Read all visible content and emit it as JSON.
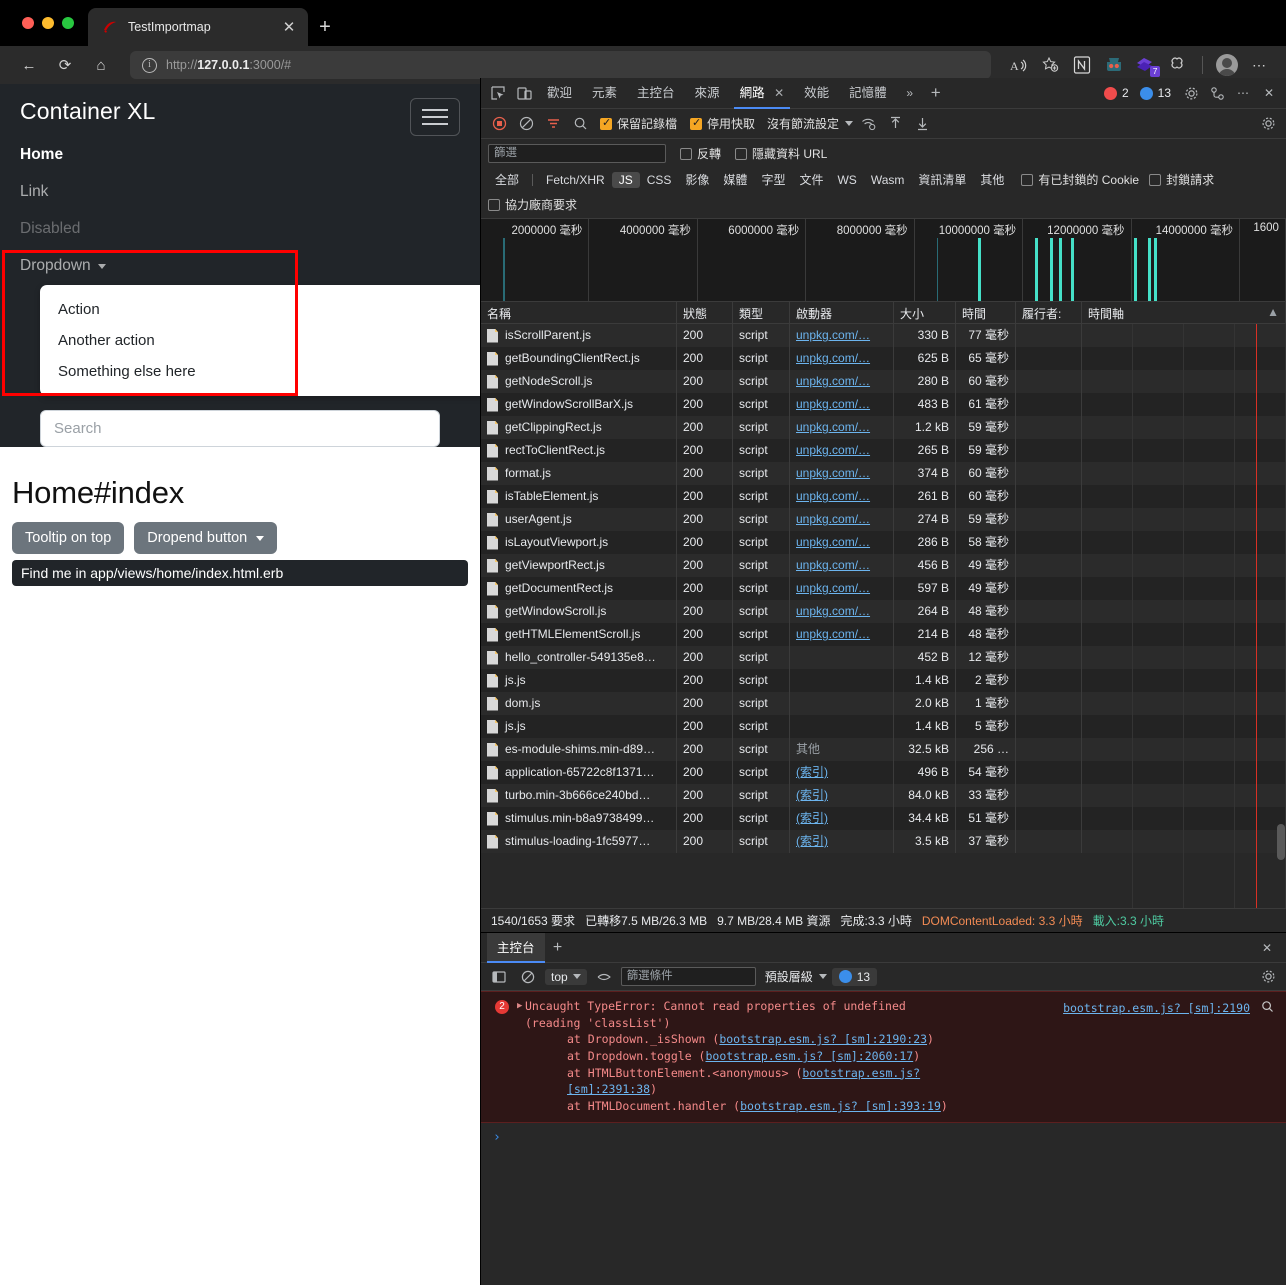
{
  "browser": {
    "tab": {
      "title": "TestImportmap",
      "close_label": "✕",
      "favicon": "rails-logo-icon"
    },
    "new_tab_label": "+",
    "nav": {
      "back": "←",
      "reload": "⟳",
      "home": "⌂"
    },
    "omnibox": {
      "info_icon": "info-circle-icon",
      "url_scheme": "http://",
      "url_host": "127.0.0.1",
      "url_rest": ":3000/#"
    },
    "toolbar_right": {
      "read_aloud": "A",
      "favorite": "☆",
      "ext_notion": "N",
      "ext_robot": "🤖",
      "ext_purple": "◆",
      "ext_badge": "7",
      "ext_puzzle": "⬡",
      "more": "⋯"
    }
  },
  "page": {
    "brand": "Container XL",
    "toggler": "navbar-toggler",
    "nav_items": [
      {
        "label": "Home",
        "state": "active"
      },
      {
        "label": "Link",
        "state": "normal"
      },
      {
        "label": "Disabled",
        "state": "disabled"
      }
    ],
    "dropdown": {
      "label": "Dropdown",
      "items": [
        "Action",
        "Another action",
        "Something else here"
      ]
    },
    "search_placeholder": "Search",
    "title": "Home#index",
    "buttons": [
      {
        "label": "Tooltip on top",
        "caret": false
      },
      {
        "label": "Dropend button",
        "caret": true
      }
    ],
    "tooltip_text": "Find me in app/views/home/index.html.erb",
    "annotation_color": "#ff0000"
  },
  "devtools": {
    "tabs": [
      {
        "label": "歡迎",
        "selected": false
      },
      {
        "label": "元素",
        "selected": false
      },
      {
        "label": "主控台",
        "selected": false
      },
      {
        "label": "來源",
        "selected": false
      },
      {
        "label": "網路",
        "selected": true,
        "closable": true
      },
      {
        "label": "效能",
        "selected": false
      },
      {
        "label": "記憶體",
        "selected": false
      }
    ],
    "more_tabs": "»",
    "add_tab": "+",
    "error_count": "2",
    "info_count": "13",
    "settings_icon": "gear-icon",
    "customize_icon": "dock-icon",
    "more_icon": "⋯",
    "close_icon": "✕",
    "network": {
      "toolbar": {
        "record_icon": "record-stop-icon",
        "clear_icon": "clear-icon",
        "filter_icon": "filter-icon",
        "search_icon": "search-icon",
        "preserve_log": "保留記錄檔",
        "disable_cache": "停用快取",
        "throttle": "沒有節流設定",
        "wifi_icon": "wifi-settings-icon",
        "import_icon": "import-har-icon",
        "export_icon": "export-har-icon",
        "settings_icon": "gear-icon"
      },
      "filter": {
        "placeholder": "篩選",
        "invert": "反轉",
        "hide_data_urls": "隱藏資料 URL",
        "types": [
          "全部",
          "Fetch/XHR",
          "JS",
          "CSS",
          "影像",
          "媒體",
          "字型",
          "文件",
          "WS",
          "Wasm",
          "資訊清單",
          "其他"
        ],
        "selected_type": "JS",
        "blocked_cookies": "有已封鎖的 Cookie",
        "blocked_requests": "封鎖請求",
        "third_party": "協力廠商要求"
      },
      "overview_ticks": [
        "2000000 毫秒",
        "4000000 毫秒",
        "6000000 毫秒",
        "8000000 毫秒",
        "10000000 毫秒",
        "12000000 毫秒",
        "14000000 毫秒",
        "1600"
      ],
      "columns": [
        "名稱",
        "狀態",
        "類型",
        "啟動器",
        "大小",
        "時間",
        "履行者:",
        "時間軸"
      ],
      "rows": [
        {
          "name": "isScrollParent.js",
          "status": "200",
          "type": "script",
          "initiator": "unpkg.com/…",
          "size": "330 B",
          "time": "77 毫秒"
        },
        {
          "name": "getBoundingClientRect.js",
          "status": "200",
          "type": "script",
          "initiator": "unpkg.com/…",
          "size": "625 B",
          "time": "65 毫秒"
        },
        {
          "name": "getNodeScroll.js",
          "status": "200",
          "type": "script",
          "initiator": "unpkg.com/…",
          "size": "280 B",
          "time": "60 毫秒"
        },
        {
          "name": "getWindowScrollBarX.js",
          "status": "200",
          "type": "script",
          "initiator": "unpkg.com/…",
          "size": "483 B",
          "time": "61 毫秒"
        },
        {
          "name": "getClippingRect.js",
          "status": "200",
          "type": "script",
          "initiator": "unpkg.com/…",
          "size": "1.2 kB",
          "time": "59 毫秒"
        },
        {
          "name": "rectToClientRect.js",
          "status": "200",
          "type": "script",
          "initiator": "unpkg.com/…",
          "size": "265 B",
          "time": "59 毫秒"
        },
        {
          "name": "format.js",
          "status": "200",
          "type": "script",
          "initiator": "unpkg.com/…",
          "size": "374 B",
          "time": "60 毫秒"
        },
        {
          "name": "isTableElement.js",
          "status": "200",
          "type": "script",
          "initiator": "unpkg.com/…",
          "size": "261 B",
          "time": "60 毫秒"
        },
        {
          "name": "userAgent.js",
          "status": "200",
          "type": "script",
          "initiator": "unpkg.com/…",
          "size": "274 B",
          "time": "59 毫秒"
        },
        {
          "name": "isLayoutViewport.js",
          "status": "200",
          "type": "script",
          "initiator": "unpkg.com/…",
          "size": "286 B",
          "time": "58 毫秒"
        },
        {
          "name": "getViewportRect.js",
          "status": "200",
          "type": "script",
          "initiator": "unpkg.com/…",
          "size": "456 B",
          "time": "49 毫秒"
        },
        {
          "name": "getDocumentRect.js",
          "status": "200",
          "type": "script",
          "initiator": "unpkg.com/…",
          "size": "597 B",
          "time": "49 毫秒"
        },
        {
          "name": "getWindowScroll.js",
          "status": "200",
          "type": "script",
          "initiator": "unpkg.com/…",
          "size": "264 B",
          "time": "48 毫秒"
        },
        {
          "name": "getHTMLElementScroll.js",
          "status": "200",
          "type": "script",
          "initiator": "unpkg.com/…",
          "size": "214 B",
          "time": "48 毫秒"
        },
        {
          "name": "hello_controller-549135e8…",
          "status": "200",
          "type": "script",
          "initiator": "",
          "size": "452 B",
          "time": "12 毫秒"
        },
        {
          "name": "js.js",
          "status": "200",
          "type": "script",
          "initiator": "",
          "size": "1.4 kB",
          "time": "2 毫秒"
        },
        {
          "name": "dom.js",
          "status": "200",
          "type": "script",
          "initiator": "",
          "size": "2.0 kB",
          "time": "1 毫秒"
        },
        {
          "name": "js.js",
          "status": "200",
          "type": "script",
          "initiator": "",
          "size": "1.4 kB",
          "time": "5 毫秒"
        },
        {
          "name": "es-module-shims.min-d89…",
          "status": "200",
          "type": "script",
          "initiator": "其他",
          "size": "32.5 kB",
          "time": "256 …"
        },
        {
          "name": "application-65722c8f1371…",
          "status": "200",
          "type": "script",
          "initiator": "(索引)",
          "size": "496 B",
          "time": "54 毫秒"
        },
        {
          "name": "turbo.min-3b666ce240bd…",
          "status": "200",
          "type": "script",
          "initiator": "(索引)",
          "size": "84.0 kB",
          "time": "33 毫秒"
        },
        {
          "name": "stimulus.min-b8a9738499…",
          "status": "200",
          "type": "script",
          "initiator": "(索引)",
          "size": "34.4 kB",
          "time": "51 毫秒"
        },
        {
          "name": "stimulus-loading-1fc5977…",
          "status": "200",
          "type": "script",
          "initiator": "(索引)",
          "size": "3.5 kB",
          "time": "37 毫秒"
        }
      ],
      "status_bar": {
        "requests": "1540/1653 要求",
        "transferred": "已轉移7.5 MB/26.3 MB",
        "resources": "9.7 MB/28.4 MB 資源",
        "finish": "完成:3.3 小時",
        "dom_content_loaded": "DOMContentLoaded: 3.3 小時",
        "load": "載入:3.3 小時"
      }
    },
    "console": {
      "tab_label": "主控台",
      "add_label": "+",
      "close_label": "✕",
      "sidebar_icon": "sidebar-icon",
      "clear_icon": "clear-icon",
      "context": "top",
      "eye_icon": "live-expression-icon",
      "filter_placeholder": "篩選條件",
      "level": "預設層級",
      "info_count": "13",
      "settings_icon": "gear-icon",
      "error": {
        "count": "2",
        "message_line1": "Uncaught TypeError: Cannot read properties of undefined",
        "message_line2": "(reading 'classList')",
        "source_link": "bootstrap.esm.js? [sm]:2190",
        "stack": [
          {
            "prefix": "at Dropdown._isShown (",
            "link": "bootstrap.esm.js? [sm]:2190:23",
            "suffix": ")"
          },
          {
            "prefix": "at Dropdown.toggle (",
            "link": "bootstrap.esm.js? [sm]:2060:17",
            "suffix": ")"
          },
          {
            "prefix": "at HTMLButtonElement.<anonymous> (",
            "link": "bootstrap.esm.js? [sm]:2391:38",
            "suffix": ")"
          },
          {
            "prefix": "at HTMLDocument.handler (",
            "link": "bootstrap.esm.js? [sm]:393:19",
            "suffix": ")"
          }
        ]
      },
      "prompt": "›"
    }
  }
}
